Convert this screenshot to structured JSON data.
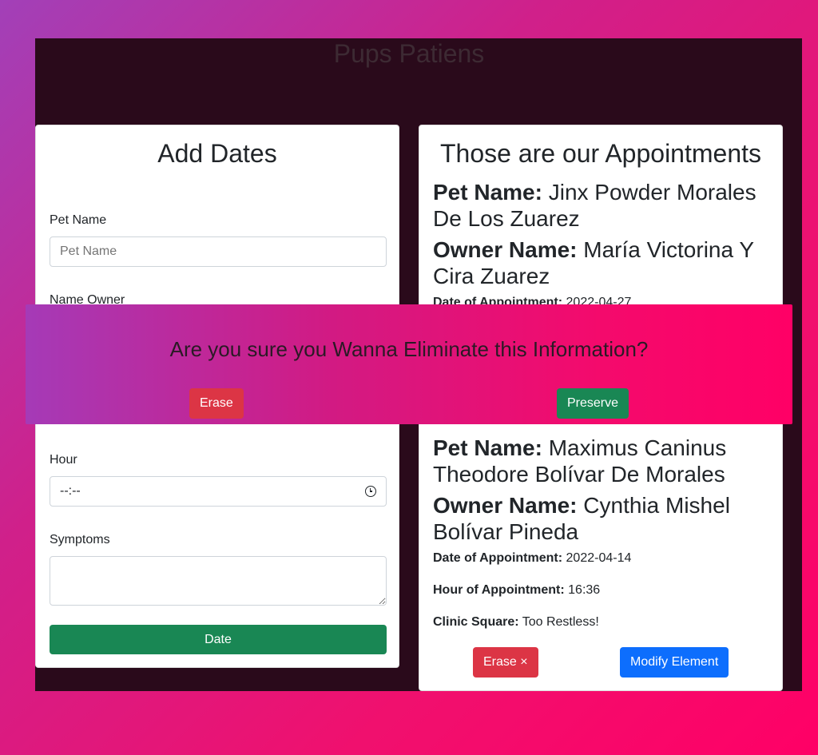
{
  "app": {
    "title": "Pups Patiens"
  },
  "form": {
    "title": "Add Dates",
    "pet_label": "Pet Name",
    "pet_placeholder": "Pet Name",
    "owner_label": "Name Owner",
    "hour_label": "Hour",
    "hour_value": "--:--",
    "symptoms_label": "Symptoms",
    "submit_label": "Date"
  },
  "list": {
    "title": "Those are our Appointments",
    "pet_name_label": "Pet Name:",
    "owner_name_label": "Owner Name:",
    "date_label": "Date of Appointment:",
    "hour_label": "Hour of Appointment:",
    "clinic_label": "Clinic Square:",
    "appointments": [
      {
        "pet_name": "Jinx Powder Morales De Los Zuarez",
        "owner_name": "María Victorina Y Cira Zuarez",
        "date": "2022-04-27"
      },
      {
        "pet_name": "Maximus Caninus Theodore Bolívar De Morales",
        "owner_name": "Cynthia Mishel Bolívar Pineda",
        "date": "2022-04-14",
        "hour": "16:36",
        "clinic": "Too Restless!",
        "erase_label": "Erase ×",
        "modify_label": "Modify Element"
      }
    ]
  },
  "modal": {
    "message": "Are you sure you Wanna Eliminate this Information?",
    "erase_label": "Erase",
    "preserve_label": "Preserve"
  },
  "colors": {
    "erase": "#dc3545",
    "preserve": "#198754",
    "modify": "#0d6efd",
    "submit": "#198754"
  }
}
